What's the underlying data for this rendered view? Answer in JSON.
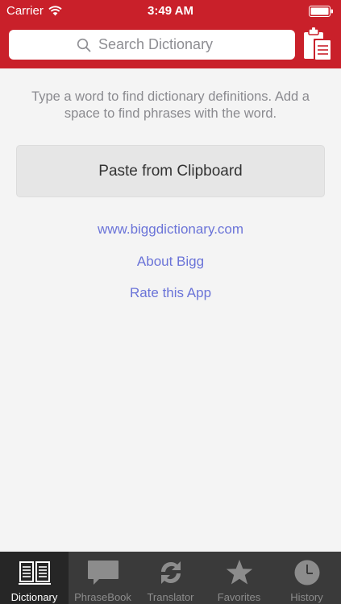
{
  "status_bar": {
    "carrier": "Carrier",
    "time": "3:49 AM"
  },
  "header": {
    "search_placeholder": "Search Dictionary",
    "clipboard_icon": "clipboard-icon",
    "background_color": "#c9202a"
  },
  "main": {
    "hint": "Type a word to find dictionary definitions. Add a space to find phrases with the word.",
    "paste_label": "Paste from Clipboard",
    "links": {
      "website": "www.biggdictionary.com",
      "about": "About Bigg",
      "rate": "Rate this App"
    },
    "link_color": "#6b74d8"
  },
  "tab_bar": {
    "tabs": [
      {
        "label": "Dictionary",
        "icon": "book-icon",
        "active": true
      },
      {
        "label": "PhraseBook",
        "icon": "speech-bubble-icon",
        "active": false
      },
      {
        "label": "Translator",
        "icon": "translate-icon",
        "active": false
      },
      {
        "label": "Favorites",
        "icon": "star-icon",
        "active": false
      },
      {
        "label": "History",
        "icon": "clock-icon",
        "active": false
      }
    ]
  }
}
